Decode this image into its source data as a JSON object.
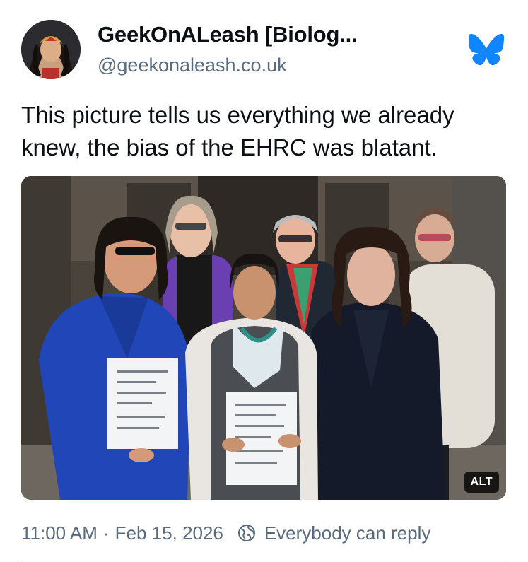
{
  "author": {
    "display_name": "GeekOnALeash [Biolog...",
    "handle": "@geekonaleash.co.uk",
    "avatar_icon": "avatar-illustration"
  },
  "platform": {
    "logo_icon": "butterfly-icon",
    "brand_color": "#1185fe"
  },
  "post": {
    "text_line_1": "This picture tells us everything we already",
    "text_line_2": "knew, the bias of the EHRC was blatant."
  },
  "media": {
    "alt_label": "ALT"
  },
  "meta": {
    "time": "11:00 AM",
    "separator": "·",
    "date": "Feb 15, 2026",
    "reply_setting": "Everybody can reply",
    "reply_icon": "reply-settings-icon"
  }
}
